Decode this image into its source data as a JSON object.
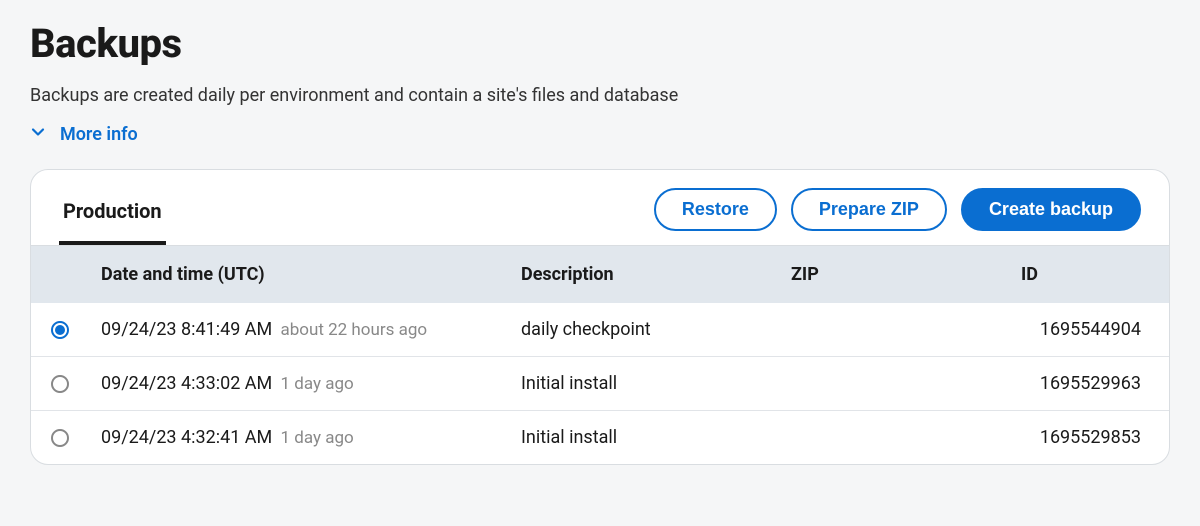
{
  "page": {
    "title": "Backups",
    "description": "Backups are created daily per environment and contain a site's files and database",
    "more_info_label": "More info"
  },
  "tabs": [
    {
      "label": "Production",
      "active": true
    }
  ],
  "actions": {
    "restore": "Restore",
    "prepare_zip": "Prepare ZIP",
    "create_backup": "Create backup"
  },
  "table": {
    "columns": {
      "date": "Date and time (UTC)",
      "description": "Description",
      "zip": "ZIP",
      "id": "ID"
    },
    "rows": [
      {
        "selected": true,
        "datetime": "09/24/23 8:41:49 AM",
        "relative": "about 22 hours ago",
        "description": "daily checkpoint",
        "zip": "",
        "id": "1695544904"
      },
      {
        "selected": false,
        "datetime": "09/24/23 4:33:02 AM",
        "relative": "1 day ago",
        "description": "Initial install",
        "zip": "",
        "id": "1695529963"
      },
      {
        "selected": false,
        "datetime": "09/24/23 4:32:41 AM",
        "relative": "1 day ago",
        "description": "Initial install",
        "zip": "",
        "id": "1695529853"
      }
    ]
  }
}
